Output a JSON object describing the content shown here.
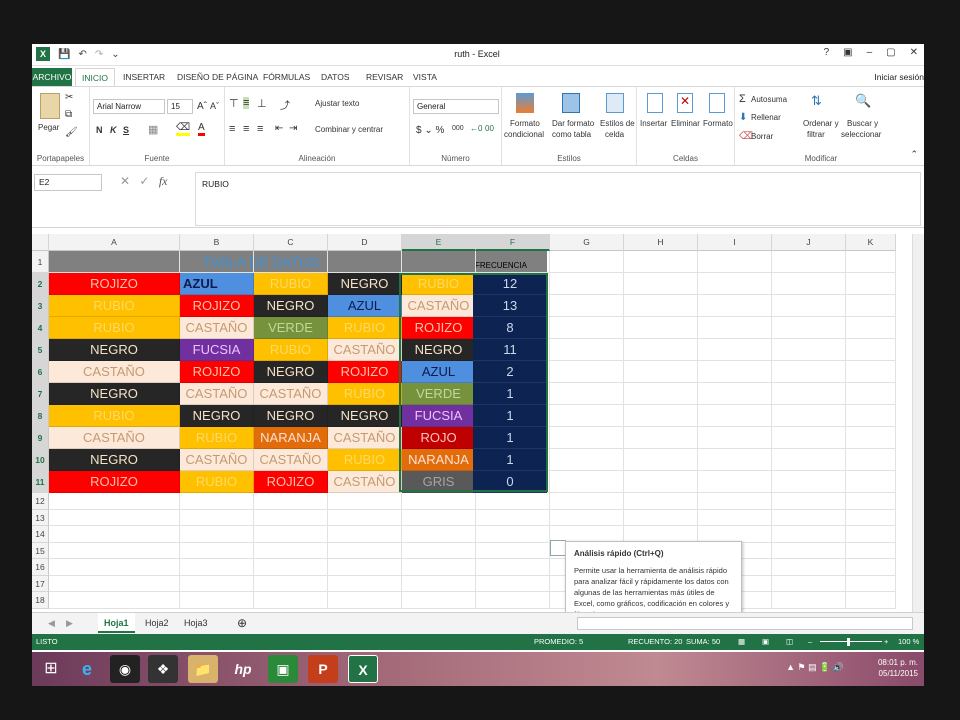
{
  "window": {
    "title": "ruth - Excel",
    "controls": [
      "?",
      "▣",
      "–",
      "▢",
      "✕"
    ]
  },
  "tabs": {
    "file": "ARCHIVO",
    "items": [
      "INICIO",
      "INSERTAR",
      "DISEÑO DE PÁGINA",
      "FÓRMULAS",
      "DATOS",
      "REVISAR",
      "VISTA"
    ],
    "signin": "Iniciar sesión"
  },
  "ribbon": {
    "paste": "Pegar",
    "clipboard_label": "Portapapeles",
    "font_name": "Arial Narrow",
    "font_size": "15",
    "bold": "N",
    "italic": "K",
    "underline": "S",
    "font_label": "Fuente",
    "wrap_text": "Ajustar texto",
    "merge_center": "Combinar y centrar",
    "alignment_label": "Alineación",
    "number_format": "General",
    "number_label": "Número",
    "cond_format_1": "Formato",
    "cond_format_2": "condicional",
    "table_format_1": "Dar formato",
    "table_format_2": "como tabla",
    "cell_styles_1": "Estilos de",
    "cell_styles_2": "celda",
    "styles_label": "Estilos",
    "insert": "Insertar",
    "delete": "Eliminar",
    "format": "Formato",
    "cells_label": "Celdas",
    "autosum": "Autosuma",
    "fill": "Rellenar",
    "clear": "Borrar",
    "sort_1": "Ordenar y",
    "sort_2": "filtrar",
    "find_1": "Buscar y",
    "find_2": "seleccionar",
    "editing_label": "Modificar"
  },
  "formula_bar": {
    "name_box": "E2",
    "fx": "fx",
    "value": "RUBIO"
  },
  "columns": [
    "A",
    "B",
    "C",
    "D",
    "E",
    "F",
    "G",
    "H",
    "I",
    "J",
    "K"
  ],
  "rows": [
    "1",
    "2",
    "3",
    "4",
    "5",
    "6",
    "7",
    "8",
    "9",
    "10",
    "11",
    "12",
    "13",
    "14",
    "15",
    "16",
    "17",
    "18"
  ],
  "table_title": "TABLA DE DATOS",
  "frequency_header": "FRECUENCIA",
  "colors": {
    "ROJIZO": {
      "bg": "#ff0000",
      "fg": "#f9c3a9"
    },
    "RUBIO": {
      "bg": "#ffc000",
      "fg": "#ffd966"
    },
    "NEGRO": {
      "bg": "#262626",
      "fg": "#f6e3c6"
    },
    "CASTAÑO": {
      "bg": "#fde9d9",
      "fg": "#c69a6f"
    },
    "AZUL": {
      "bg": "#4f8fe0",
      "fg": "#0d1b4d"
    },
    "VERDE": {
      "bg": "#76923c",
      "fg": "#c4d79b"
    },
    "FUCSIA": {
      "bg": "#7030a0",
      "fg": "#f2c1ff"
    },
    "NARANJA": {
      "bg": "#e26b0a",
      "fg": "#fbe2d5"
    },
    "ROJO": {
      "bg": "#c00000",
      "fg": "#ffc1c1"
    },
    "GRIS": {
      "bg": "#595959",
      "fg": "#a4a4a4"
    }
  },
  "data_rows": [
    [
      "ROJIZO",
      "AZUL",
      "RUBIO",
      "NEGRO",
      "RUBIO",
      "12"
    ],
    [
      "RUBIO",
      "ROJIZO",
      "NEGRO",
      "AZUL",
      "CASTAÑO",
      "13"
    ],
    [
      "RUBIO",
      "CASTAÑO",
      "VERDE",
      "RUBIO",
      "ROJIZO",
      "8"
    ],
    [
      "NEGRO",
      "FUCSIA",
      "RUBIO",
      "CASTAÑO",
      "NEGRO",
      "11"
    ],
    [
      "CASTAÑO",
      "ROJIZO",
      "NEGRO",
      "ROJIZO",
      "AZUL",
      "2"
    ],
    [
      "NEGRO",
      "CASTAÑO",
      "CASTAÑO",
      "RUBIO",
      "VERDE",
      "1"
    ],
    [
      "RUBIO",
      "NEGRO",
      "NEGRO",
      "NEGRO",
      "FUCSIA",
      "1"
    ],
    [
      "CASTAÑO",
      "RUBIO",
      "NARANJA",
      "CASTAÑO",
      "ROJO",
      "1"
    ],
    [
      "NEGRO",
      "CASTAÑO",
      "CASTAÑO",
      "RUBIO",
      "NARANJA",
      "1"
    ],
    [
      "ROJIZO",
      "RUBIO",
      "ROJIZO",
      "CASTAÑO",
      "GRIS",
      "0"
    ]
  ],
  "quick_analysis": {
    "title": "Análisis rápido (Ctrl+Q)",
    "body": "Permite usar la herramienta de análisis rápido para analizar fácil y rápidamente los datos con algunas de las herramientas más útiles de Excel, como gráficos, codificación en colores y fórmulas."
  },
  "sheets": [
    "Hoja1",
    "Hoja2",
    "Hoja3"
  ],
  "status": {
    "mode": "LISTO",
    "average": "PROMEDIO: 5",
    "count": "RECUENTO: 20",
    "sum": "SUMA: 50",
    "zoom": "100 %"
  },
  "taskbar": {
    "time": "08:01 p. m.",
    "date": "05/11/2015"
  }
}
